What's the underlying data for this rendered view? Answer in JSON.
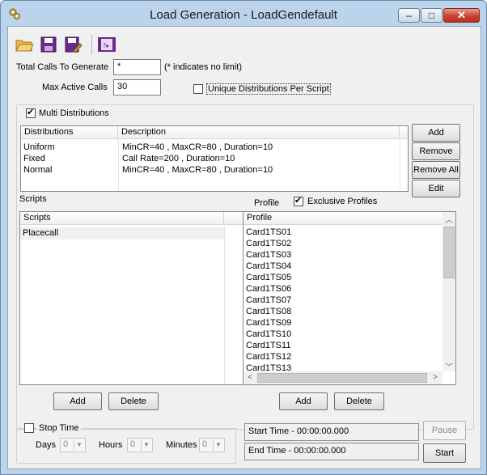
{
  "window": {
    "title": "Load Generation - LoadGendefault",
    "icon": "gear-icon",
    "controls": {
      "minimize": "–",
      "maximize": "□",
      "close": "✕"
    }
  },
  "toolbar": {
    "icons": [
      "open-folder-icon",
      "save-icon",
      "save-as-icon",
      "record-icon"
    ]
  },
  "settings": {
    "total_calls_label": "Total Calls To Generate",
    "total_calls_value": "*",
    "total_calls_hint": "(* indicates no limit)",
    "max_active_label": "Max Active Calls",
    "max_active_value": "30",
    "unique_dist_label": "Unique Distributions Per Script",
    "unique_dist_checked": false
  },
  "distributions": {
    "multi_label": "Multi Distributions",
    "multi_checked": true,
    "columns": [
      "Distributions",
      "Description"
    ],
    "rows": [
      {
        "name": "Uniform",
        "description": "MinCR=40 , MaxCR=80 , Duration=10"
      },
      {
        "name": "Fixed",
        "description": "Call Rate=200 , Duration=10"
      },
      {
        "name": "Normal",
        "description": "MinCR=40 , MaxCR=80 , Duration=10"
      }
    ],
    "buttons": {
      "add": "Add",
      "remove": "Remove",
      "remove_all": "Remove All",
      "edit": "Edit"
    }
  },
  "scripts": {
    "group_label": "Scripts",
    "column": "Scripts",
    "rows": [
      "Placecall"
    ],
    "add_label": "Add",
    "delete_label": "Delete"
  },
  "profiles": {
    "group_label": "Profile",
    "exclusive_label": "Exclusive Profiles",
    "exclusive_checked": true,
    "column": "Profile",
    "rows": [
      "Card1TS01",
      "Card1TS02",
      "Card1TS03",
      "Card1TS04",
      "Card1TS05",
      "Card1TS06",
      "Card1TS07",
      "Card1TS08",
      "Card1TS09",
      "Card1TS10",
      "Card1TS11",
      "Card1TS12",
      "Card1TS13"
    ],
    "add_label": "Add",
    "delete_label": "Delete"
  },
  "timing": {
    "stop_time_label": "Stop Time",
    "stop_time_checked": false,
    "days_label": "Days",
    "days_value": "0",
    "hours_label": "Hours",
    "hours_value": "0",
    "minutes_label": "Minutes",
    "minutes_value": "0",
    "start_time": "Start Time - 00:00:00.000",
    "end_time": "End Time  - 00:00:00.000",
    "pause_label": "Pause",
    "start_label": "Start"
  }
}
